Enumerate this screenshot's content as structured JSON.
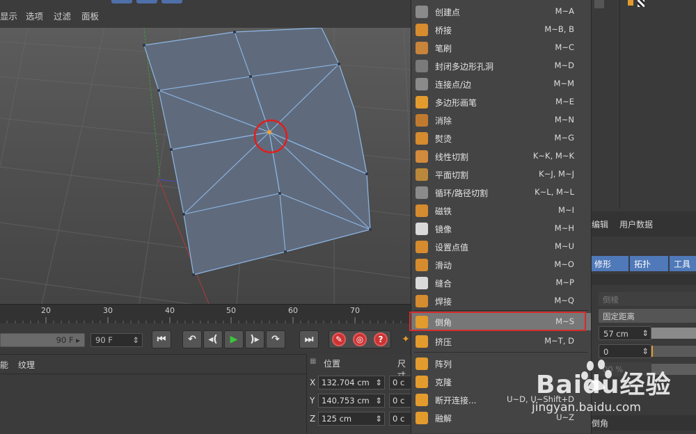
{
  "menubar": {
    "items": [
      "显示",
      "选项",
      "过滤",
      "面板"
    ]
  },
  "timeline": {
    "ticks": [
      "20",
      "30",
      "40",
      "50",
      "60",
      "70"
    ]
  },
  "transport": {
    "end_frame_value": "90 F",
    "end_frame_field": "90 F"
  },
  "bottom_panel": {
    "tabs": [
      "能",
      "纹理"
    ]
  },
  "coordinates": {
    "header": "位置",
    "header2": "尺寸",
    "rows": [
      {
        "axis": "X",
        "value": "132.704 cm",
        "size": "0 c"
      },
      {
        "axis": "Y",
        "value": "140.753 cm",
        "size": "0 c"
      },
      {
        "axis": "Z",
        "value": "125 cm",
        "size": "0 c"
      }
    ]
  },
  "context_menu": {
    "items": [
      {
        "label": "创建点",
        "shortcut": "M~A",
        "icon": "create-point-icon",
        "color": "#d58b2e"
      },
      {
        "label": "桥接",
        "shortcut": "M~B, B",
        "icon": "bridge-icon",
        "color": "#d58b2e"
      },
      {
        "label": "笔刷",
        "shortcut": "M~C",
        "icon": "brush-icon",
        "color": "#c8843a"
      },
      {
        "label": "封闭多边形孔洞",
        "shortcut": "M~D",
        "icon": "close-hole-icon",
        "color": "#7a7a7a"
      },
      {
        "label": "连接点/边",
        "shortcut": "M~M",
        "icon": "connect-icon",
        "color": "#8a8a8a"
      },
      {
        "label": "多边形画笔",
        "shortcut": "M~E",
        "icon": "polygon-pen-icon",
        "color": "#e39b2e"
      },
      {
        "label": "消除",
        "shortcut": "M~N",
        "icon": "dissolve-icon",
        "color": "#c07a30"
      },
      {
        "label": "熨烫",
        "shortcut": "M~G",
        "icon": "iron-icon",
        "color": "#d58b2e"
      },
      {
        "label": "线性切割",
        "shortcut": "K~K, M~K",
        "icon": "knife-line-icon",
        "color": "#d28a3c"
      },
      {
        "label": "平面切割",
        "shortcut": "K~J, M~J",
        "icon": "knife-plane-icon",
        "color": "#b9883a"
      },
      {
        "label": "循环/路径切割",
        "shortcut": "K~L, M~L",
        "icon": "loop-cut-icon",
        "color": "#8b8b8b"
      },
      {
        "label": "磁铁",
        "shortcut": "M~I",
        "icon": "magnet-icon",
        "color": "#d58b2e"
      },
      {
        "label": "镜像",
        "shortcut": "M~H",
        "icon": "mirror-icon",
        "color": "#d9d9d9"
      },
      {
        "label": "设置点值",
        "shortcut": "M~U",
        "icon": "set-point-value-icon",
        "color": "#d58b2e"
      },
      {
        "label": "滑动",
        "shortcut": "M~O",
        "icon": "slide-icon",
        "color": "#d58b2e"
      },
      {
        "label": "缝合",
        "shortcut": "M~P",
        "icon": "stitch-icon",
        "color": "#d9d9d9"
      },
      {
        "label": "焊接",
        "shortcut": "M~Q",
        "icon": "weld-icon",
        "color": "#d58b2e"
      },
      {
        "label": "倒角",
        "shortcut": "M~S",
        "icon": "bevel-icon",
        "color": "#e39b2e"
      },
      {
        "label": "挤压",
        "shortcut": "M~T, D",
        "icon": "extrude-icon",
        "color": "#e39b2e"
      },
      {
        "label": "阵列",
        "shortcut": "",
        "icon": "array-icon",
        "color": "#e39b2e"
      },
      {
        "label": "克隆",
        "shortcut": "",
        "icon": "clone-icon",
        "color": "#e39b2e"
      },
      {
        "label": "断开连接...",
        "shortcut": "U~D, U~Shift+D",
        "icon": "disconnect-icon",
        "color": "#e39b2e"
      },
      {
        "label": "融解",
        "shortcut": "U~Z",
        "icon": "melt-icon",
        "color": "#e39b2e"
      }
    ]
  },
  "right_panel": {
    "header_items": [
      "编辑",
      "用户数据"
    ],
    "tabs": [
      "修形",
      "拓扑",
      "工具"
    ],
    "bevel_label": "倒棱",
    "mode_value": "固定距离",
    "offset_value": "57 cm",
    "subdivision_value": "0",
    "depth_value": "00 %",
    "bottom_label": "倒角"
  },
  "watermark": {
    "brand": "Baidu经验",
    "url": "jingyan.baidu.com"
  },
  "colors": {
    "highlight_border": "#d62b2b",
    "tab_blue": "#4f79b8",
    "mesh_fill": "#5f6b7d",
    "mesh_edge": "#8fb8e6"
  }
}
